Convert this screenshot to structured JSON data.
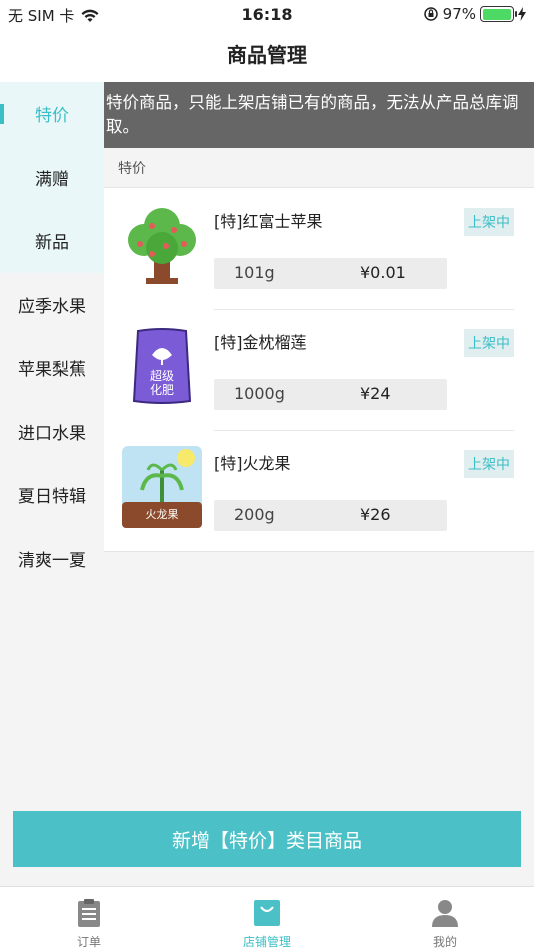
{
  "status": {
    "carrier": "无 SIM 卡",
    "time": "16:18",
    "battery": "97%",
    "battery_level": 0.97
  },
  "nav": {
    "title": "商品管理"
  },
  "sidebar": {
    "items": [
      {
        "label": "特价"
      },
      {
        "label": "满赠"
      },
      {
        "label": "新品"
      },
      {
        "label": "应季水果"
      },
      {
        "label": "苹果梨蕉"
      },
      {
        "label": "进口水果"
      },
      {
        "label": "夏日特辑"
      },
      {
        "label": "清爽一夏"
      }
    ]
  },
  "notice": "特价商品，只能上架店铺已有的商品，无法从产品总库调取。",
  "section": {
    "title": "特价"
  },
  "products": [
    {
      "name": "[特]红富士苹果",
      "status": "上架中",
      "weight": "101g",
      "price": "¥0.01"
    },
    {
      "name": "[特]金枕榴莲",
      "status": "上架中",
      "weight": "1000g",
      "price": "¥24",
      "thumb_text_1": "超级",
      "thumb_text_2": "化肥"
    },
    {
      "name": "[特]火龙果",
      "status": "上架中",
      "weight": "200g",
      "price": "¥26",
      "thumb_text": "火龙果"
    }
  ],
  "add_button": "新增【特价】类目商品",
  "tabs": [
    {
      "label": "订单"
    },
    {
      "label": "店铺管理"
    },
    {
      "label": "我的"
    }
  ],
  "colors": {
    "accent": "#3bbfc6",
    "button": "#4bc1c7",
    "notice_bg": "#666666"
  }
}
